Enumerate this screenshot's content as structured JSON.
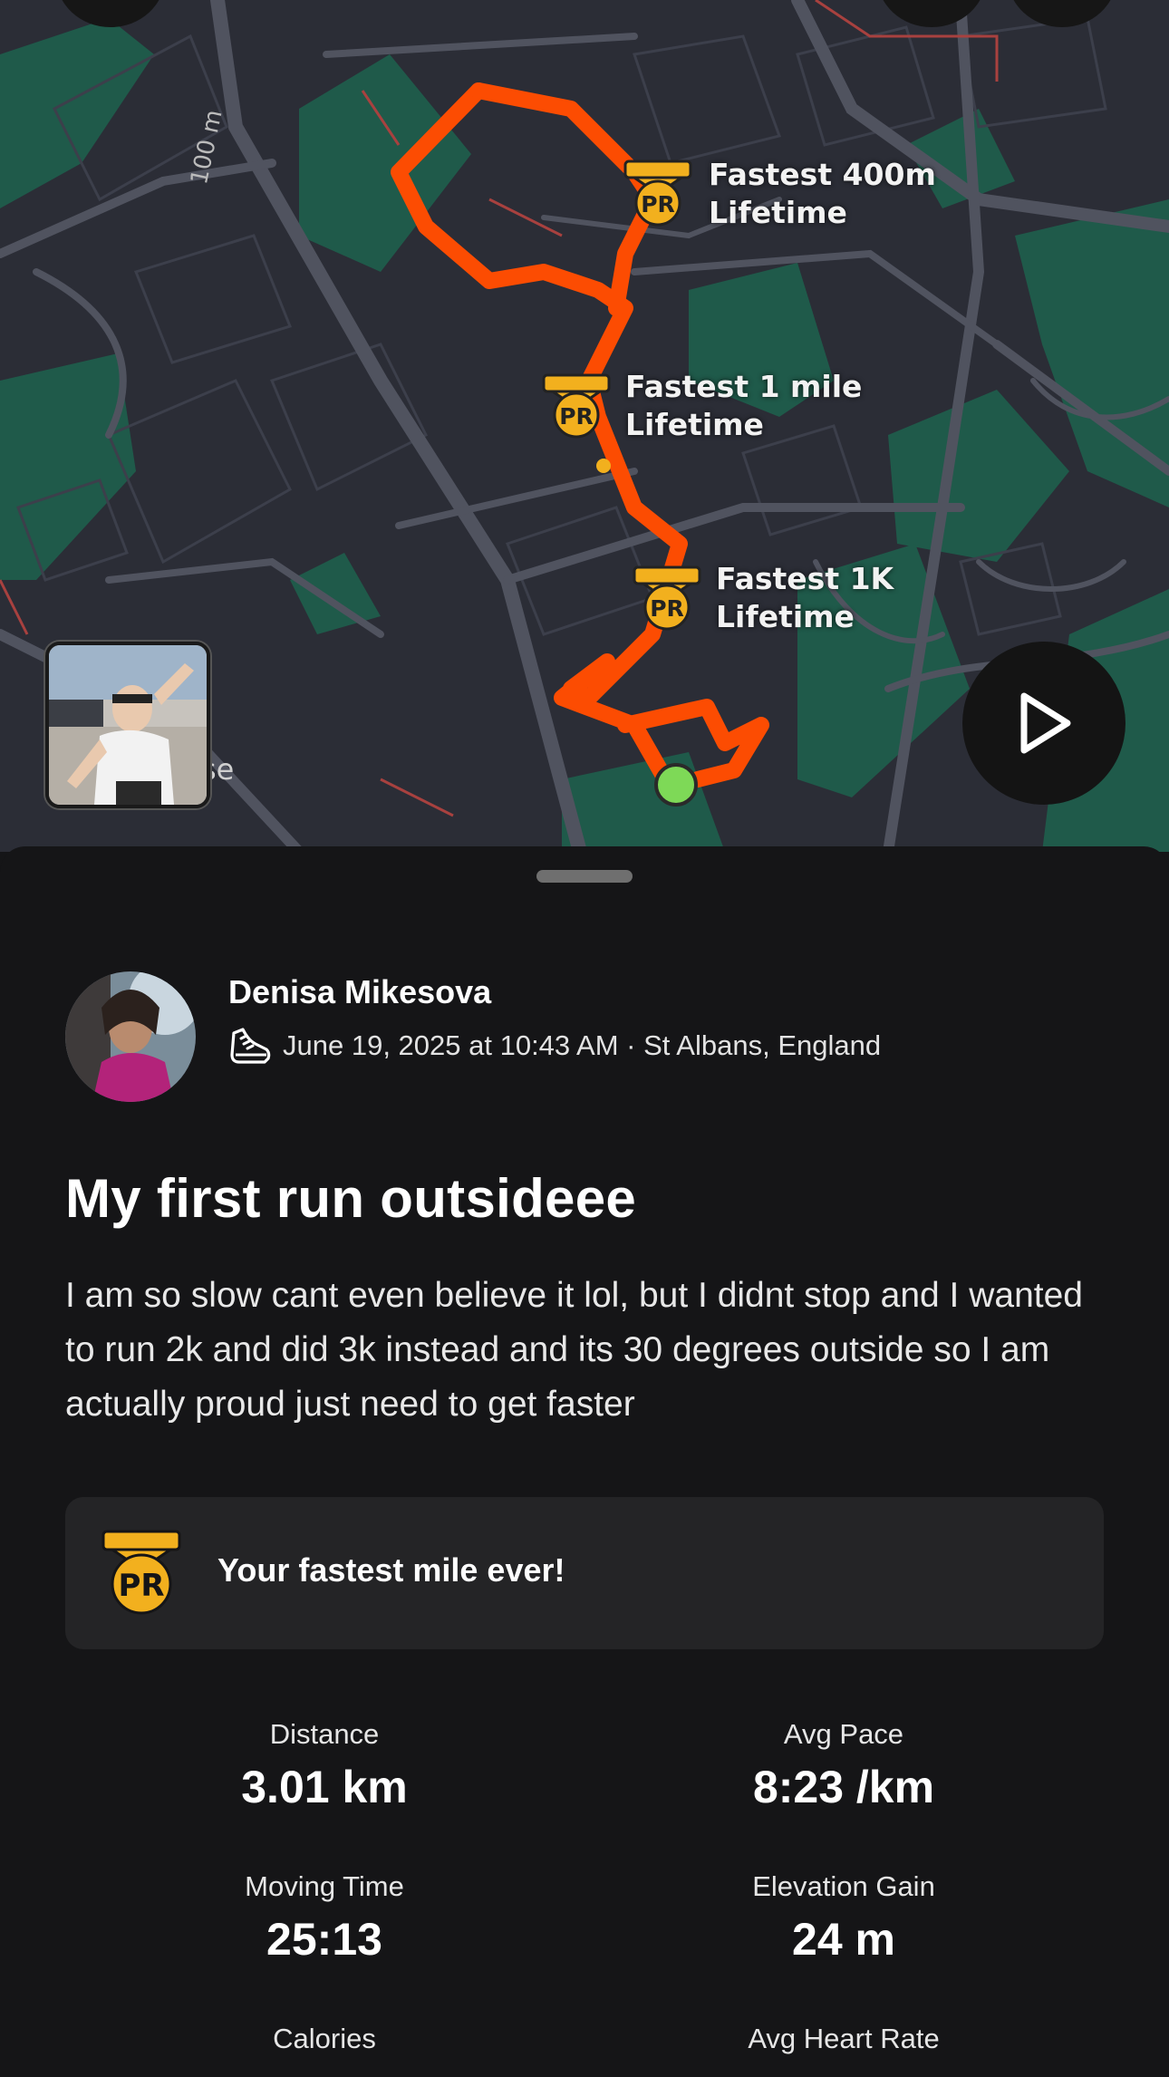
{
  "map": {
    "scale_label": "100 m",
    "street_label_fragment": "se",
    "pr_markers": [
      {
        "title": "Fastest 400m",
        "subtitle": "Lifetime",
        "badge": "PR"
      },
      {
        "title": "Fastest 1 mile",
        "subtitle": "Lifetime",
        "badge": "PR"
      },
      {
        "title": "Fastest 1K",
        "subtitle": "Lifetime",
        "badge": "PR"
      }
    ],
    "route_color": "#fc4c02",
    "start_marker_color": "#7ed957",
    "play_icon": "play-icon",
    "photo_icon": "activity-photo"
  },
  "activity": {
    "athlete_name": "Denisa Mikesova",
    "sport_icon": "shoe-icon",
    "meta": "June 19, 2025 at 10:43 AM · St Albans, England",
    "title": "My first run outsideee",
    "description": "I am so slow cant even believe it lol, but I didnt stop and I wanted to run 2k and did 3k instead and its 30 degrees outside so I am actually proud just need to get faster",
    "achievement": {
      "badge": "PR",
      "text": "Your fastest mile ever!"
    },
    "stats": [
      {
        "label": "Distance",
        "value": "3.01 km"
      },
      {
        "label": "Avg Pace",
        "value": "8:23 /km"
      },
      {
        "label": "Moving Time",
        "value": "25:13"
      },
      {
        "label": "Elevation Gain",
        "value": "24 m"
      },
      {
        "label": "Calories",
        "value": ""
      },
      {
        "label": "Avg Heart Rate",
        "value": ""
      }
    ]
  },
  "colors": {
    "badge_gold": "#f2b01e",
    "background": "#151517",
    "card": "#242426"
  }
}
